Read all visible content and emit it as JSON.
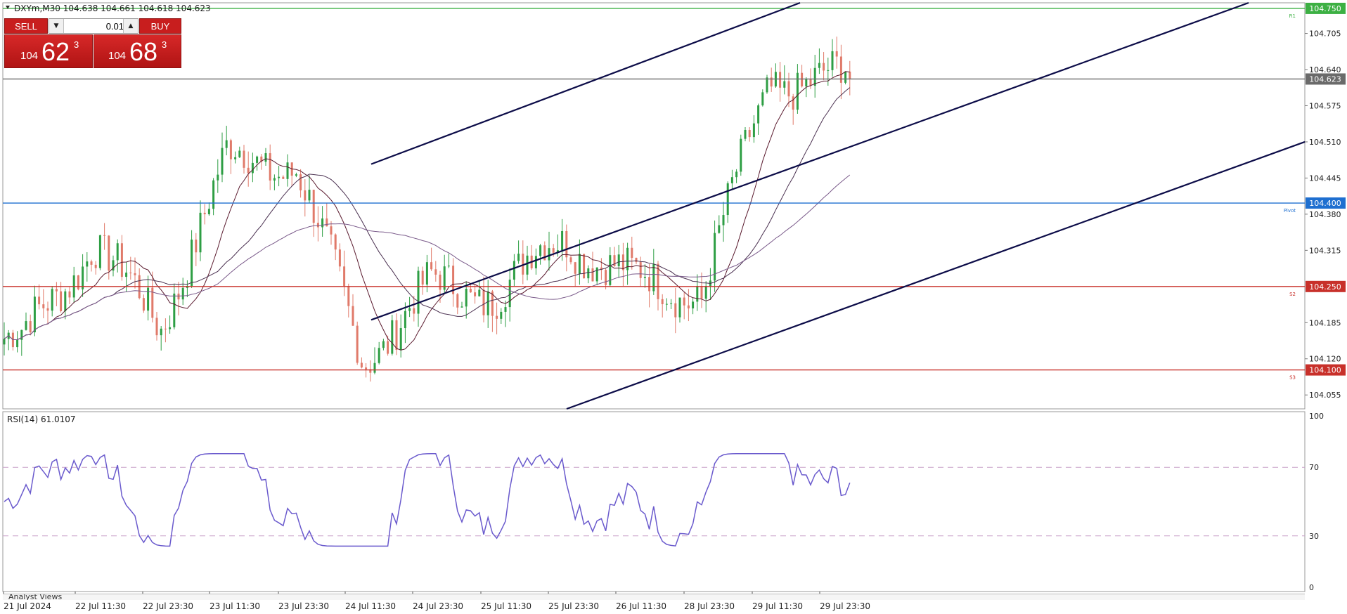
{
  "header": {
    "info": "DXYm,M30  104.638 104.661 104.618 104.623"
  },
  "trade_panel": {
    "sell_label": "SELL",
    "buy_label": "BUY",
    "lot_value": "0.01",
    "sell_price_prefix": "104",
    "sell_price_big": "62",
    "sell_price_sup": "3",
    "buy_price_prefix": "104",
    "buy_price_big": "68",
    "buy_price_sup": "3",
    "spin_down_icon": "triangle-down",
    "spin_up_icon": "triangle-up"
  },
  "price_axis_ticks": [
    "104.705",
    "104.640",
    "104.575",
    "104.510",
    "104.445",
    "104.380",
    "104.315",
    "104.185",
    "104.120",
    "104.055"
  ],
  "level_lines": [
    {
      "price": 104.75,
      "label": "104.750",
      "tag": "R1",
      "color": "#3cb043"
    },
    {
      "price": 104.623,
      "label": "104.623",
      "tag": "",
      "color": "#6a6a6a"
    },
    {
      "price": 104.4,
      "label": "104.400",
      "tag": "Pivot",
      "color": "#1e6fd0"
    },
    {
      "price": 104.25,
      "label": "104.250",
      "tag": "S2",
      "color": "#c8302a"
    },
    {
      "price": 104.1,
      "label": "104.100",
      "tag": "S3",
      "color": "#c8302a"
    }
  ],
  "colors": {
    "bull": "#2e9e44",
    "bear": "#e07a6a",
    "channel": "#0c0c48",
    "ma_dark": "#5a1a2e",
    "ma_mid": "#4a3050",
    "ma_slow": "#7a5a8a",
    "rsi": "#6a5acd",
    "rsi_levels": "#c8a0c8"
  },
  "time_labels": [
    "21 Jul 2024",
    "22 Jul 11:30",
    "22 Jul 23:30",
    "23 Jul 11:30",
    "23 Jul 23:30",
    "24 Jul 11:30",
    "24 Jul 23:30",
    "25 Jul 11:30",
    "25 Jul 23:30",
    "26 Jul 11:30",
    "28 Jul 23:30",
    "29 Jul 11:30",
    "29 Jul 23:30"
  ],
  "rsi": {
    "label": "RSI(14) 61.0107",
    "scale_ticks": [
      "100",
      "70",
      "30",
      "0"
    ],
    "levels": [
      70,
      30
    ]
  },
  "bottom_tab": {
    "label": "Analyst Views"
  },
  "chart_data": {
    "type": "candlestick",
    "symbol": "DXYm",
    "timeframe": "M30",
    "ylim": [
      104.03,
      104.76
    ],
    "ohlc_last": {
      "open": 104.638,
      "high": 104.661,
      "low": 104.618,
      "close": 104.623
    },
    "close_path": [
      {
        "t": "21 Jul 2024",
        "price": 104.15
      },
      {
        "t": "22 Jul 11:30",
        "price": 104.33
      },
      {
        "t": "22 Jul 23:30",
        "price": 104.18
      },
      {
        "t": "23 Jul 11:30",
        "price": 104.48
      },
      {
        "t": "23 Jul 23:30",
        "price": 104.47
      },
      {
        "t": "24 Jul 11:30",
        "price": 104.12
      },
      {
        "t": "24 Jul 23:30",
        "price": 104.25
      },
      {
        "t": "25 Jul 11:30",
        "price": 104.24
      },
      {
        "t": "25 Jul 23:30",
        "price": 104.34
      },
      {
        "t": "26 Jul 11:30",
        "price": 104.26
      },
      {
        "t": "28 Jul 23:30",
        "price": 104.24
      },
      {
        "t": "29 Jul 11:30",
        "price": 104.62
      },
      {
        "t": "29 Jul 23:30",
        "price": 104.623
      }
    ],
    "channel_lines": [
      {
        "name": "upper",
        "from_price": 104.47,
        "to_price": 104.76
      },
      {
        "name": "middle",
        "from_price": 104.19,
        "to_price": 104.76
      },
      {
        "name": "lower",
        "from_price": 104.03,
        "to_price": 104.51
      }
    ],
    "rsi_last": 61.0107
  }
}
